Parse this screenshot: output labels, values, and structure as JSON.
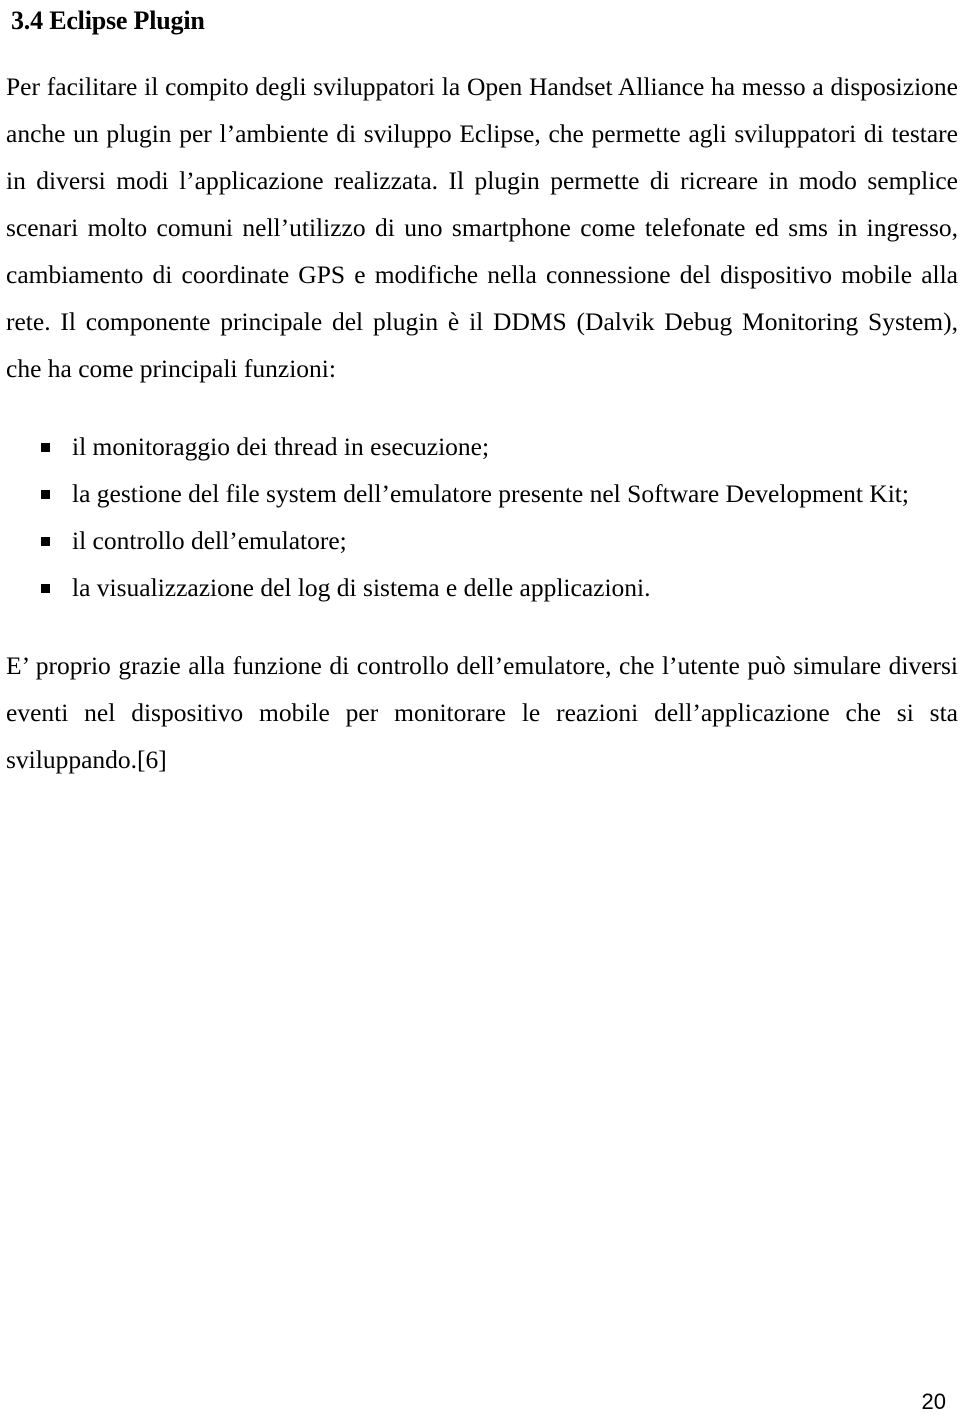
{
  "document": {
    "heading": "3.4 Eclipse Plugin",
    "paragraphs": {
      "intro": "Per facilitare il compito degli sviluppatori la Open Handset Alliance ha messo a disposizione anche un plugin per l’ambiente di sviluppo Eclipse, che permette agli sviluppatori di testare in diversi modi l’applicazione realizzata. Il plugin permette di ricreare in modo semplice scenari molto comuni nell’utilizzo di uno smartphone come telefonate ed sms in ingresso, cambiamento di coordinate GPS e modifiche nella connessione del dispositivo mobile alla rete. Il componente principale del plugin è il DDMS (Dalvik Debug Monitoring System), che ha come principali funzioni:",
      "closing": "E’ proprio grazie alla funzione di controllo dell’emulatore, che l’utente può simulare diversi eventi nel dispositivo mobile per monitorare le reazioni dell’applicazione che si sta sviluppando.[6]"
    },
    "bullets": [
      "il monitoraggio dei thread in esecuzione;",
      "la gestione del file system dell’emulatore presente nel Software Development Kit;",
      "il controllo dell’emulatore;",
      "la visualizzazione del log di sistema e delle applicazioni."
    ],
    "bullet_marker": "square-bullet",
    "page_number": "20",
    "colors": {
      "text": "#000000",
      "background": "#ffffff"
    }
  }
}
